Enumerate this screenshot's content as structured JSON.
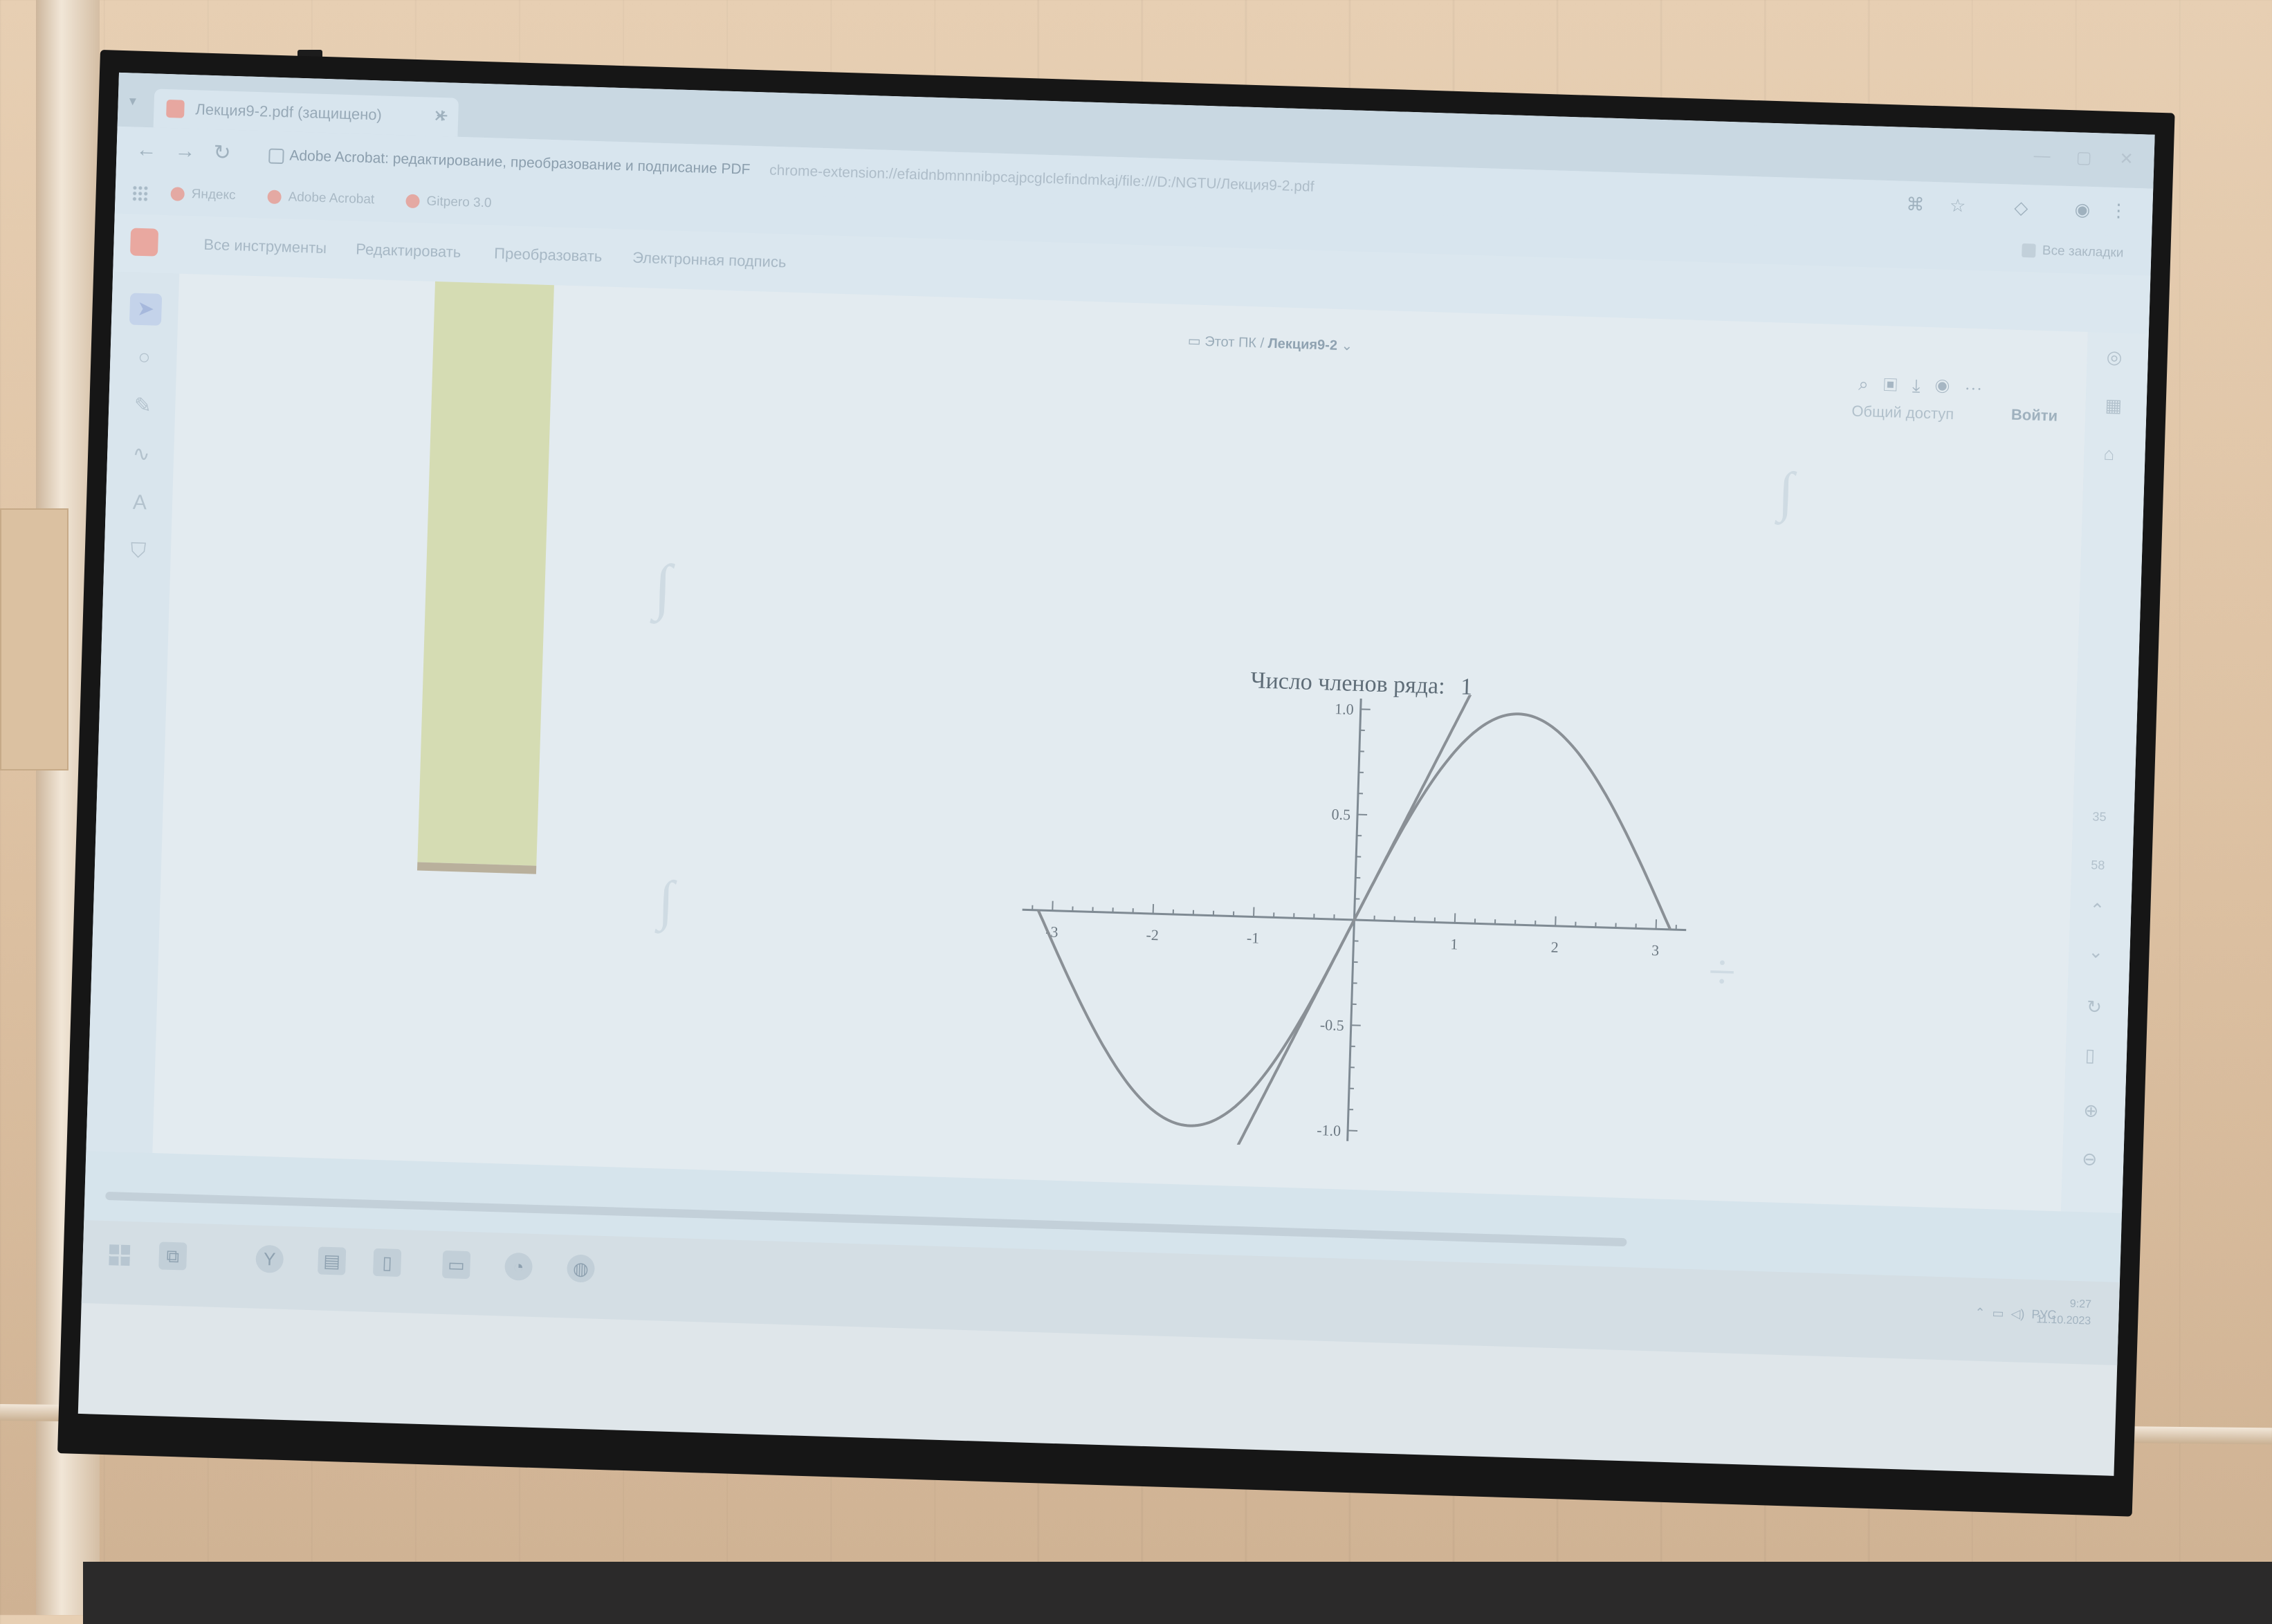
{
  "browser": {
    "tab_title": "Лекция9-2.pdf (защищено)",
    "page_title": "Adobe Acrobat: редактирование, преобразование и подписание PDF",
    "url": "chrome-extension://efaidnbmnnnibpcajpcglclefindmkaj/file:///D:/NGTU/Лекция9-2.pdf",
    "bookmarks": [
      "Яндекс",
      "Adobe Acrobat",
      "Gitpero 3.0"
    ]
  },
  "acrobat": {
    "menu": [
      "Все инструменты",
      "Редактировать",
      "Преобразовать",
      "Электронная подпись"
    ],
    "breadcrumb_location": "Этот ПК",
    "breadcrumb_file": "Лекция9-2",
    "all_bookmarks_label": "Все закладки",
    "share_label": "Общий доступ",
    "signin_label": "Войти",
    "page_numbers": [
      "35",
      "58"
    ]
  },
  "taskbar": {
    "language": "РУС",
    "time": "9:27",
    "date": "11.10.2023"
  },
  "chart_data": {
    "type": "line",
    "title": "Число членов ряда:",
    "title_value": "1",
    "xlim": [
      -3.1416,
      3.1416
    ],
    "ylim": [
      -1.0,
      1.0
    ],
    "x_ticks": [
      "-3",
      "-2",
      "-1",
      "1",
      "2",
      "3"
    ],
    "y_ticks": [
      "1.0",
      "0.5",
      "-0.5",
      "-1.0"
    ],
    "series": [
      {
        "function": "sin(x)",
        "x_range": [
          -3.1416,
          3.1416
        ],
        "color": "#8a9096"
      },
      {
        "function": "x",
        "x_range": [
          -1.25,
          1.25
        ],
        "color": "#8a9096"
      }
    ],
    "grid": false
  }
}
